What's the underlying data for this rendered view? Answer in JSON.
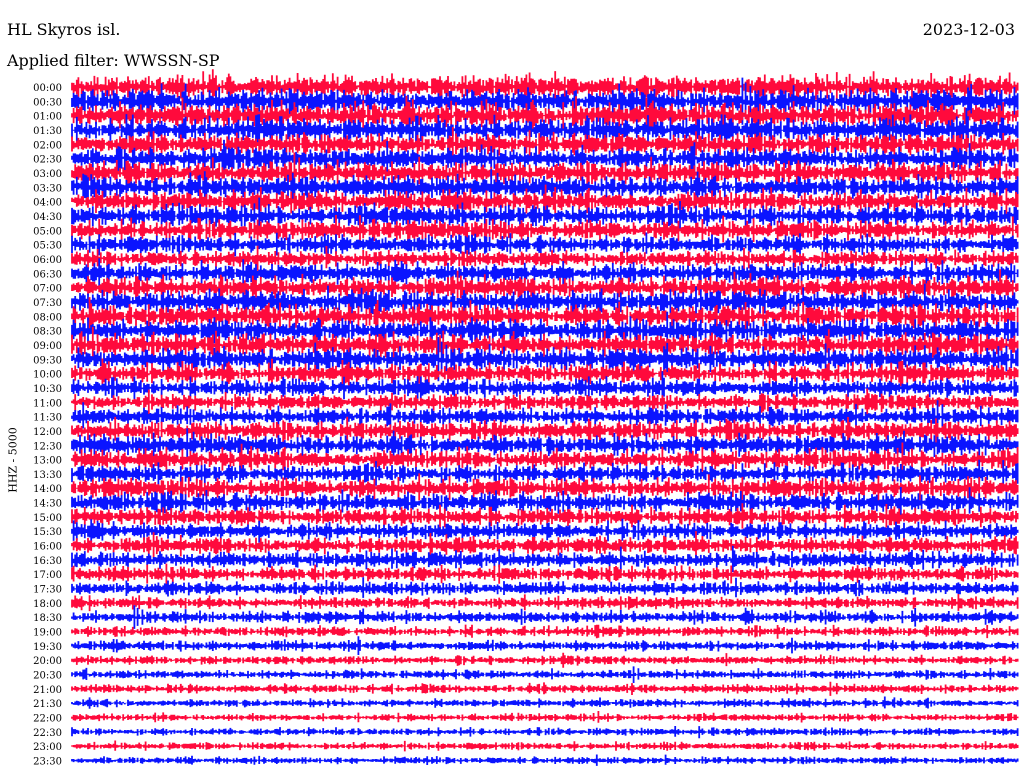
{
  "header": {
    "station": "HL Skyros isl.",
    "date": "2023-12-03",
    "filter": "Applied filter: WWSSN-SP"
  },
  "colors": {
    "trace_a": "#ff0a3c",
    "trace_b": "#0a14ff",
    "background": "#ffffff"
  },
  "chart_data": {
    "type": "line",
    "title": "HL Skyros isl.",
    "ylabel": "HHZ - 5000",
    "xlabel": "",
    "row_labels": [
      "00:00",
      "00:30",
      "01:00",
      "01:30",
      "02:00",
      "02:30",
      "03:00",
      "03:30",
      "04:00",
      "04:30",
      "05:00",
      "05:30",
      "06:00",
      "06:30",
      "07:00",
      "07:30",
      "08:00",
      "08:30",
      "09:00",
      "09:30",
      "10:00",
      "10:30",
      "11:00",
      "11:30",
      "12:00",
      "12:30",
      "13:00",
      "13:30",
      "14:00",
      "14:30",
      "15:00",
      "15:30",
      "16:00",
      "16:30",
      "17:00",
      "17:30",
      "18:00",
      "18:30",
      "19:00",
      "19:30",
      "20:00",
      "20:30",
      "21:00",
      "21:30",
      "22:00",
      "22:30",
      "23:00",
      "23:30"
    ],
    "series_colors_alternating": [
      "trace_a",
      "trace_b"
    ],
    "relative_noise_amplitude": [
      1.6,
      1.6,
      1.7,
      1.6,
      1.5,
      1.5,
      1.5,
      1.5,
      1.4,
      1.4,
      1.3,
      1.2,
      1.1,
      1.3,
      1.4,
      1.5,
      1.5,
      1.5,
      1.5,
      1.5,
      1.3,
      1.2,
      1.1,
      1.2,
      1.3,
      1.4,
      1.3,
      1.2,
      1.3,
      1.3,
      1.2,
      1.1,
      1.1,
      1.1,
      1.0,
      0.9,
      0.8,
      0.8,
      0.7,
      0.7,
      0.6,
      0.6,
      0.6,
      0.55,
      0.5,
      0.5,
      0.5,
      0.5
    ],
    "grid": false,
    "legend": "none"
  }
}
